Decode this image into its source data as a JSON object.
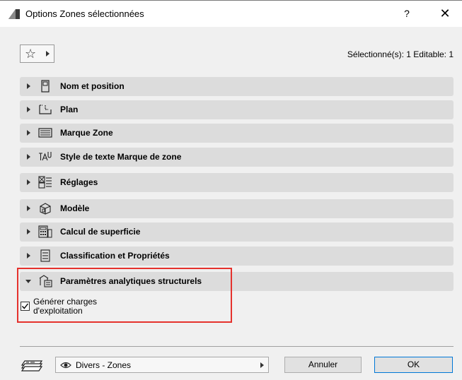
{
  "window": {
    "title": "Options Zones sélectionnées",
    "help_label": "?",
    "close_label": "✕"
  },
  "toolbar": {
    "favorites_icon": "star-icon",
    "selection_info": "Sélectionné(s): 1 Editable: 1"
  },
  "panels": [
    {
      "label": "Nom et position",
      "icon": "name-position-icon",
      "expanded": false
    },
    {
      "label": "Plan",
      "icon": "floor-plan-icon",
      "expanded": false
    },
    {
      "label": "Marque Zone",
      "icon": "zone-stamp-icon",
      "expanded": false
    },
    {
      "label": "Style de texte Marque de zone",
      "icon": "text-style-icon",
      "expanded": false
    },
    {
      "label": "Réglages",
      "icon": "settings-icon",
      "expanded": false
    },
    {
      "label": "Modèle",
      "icon": "model-icon",
      "expanded": false
    },
    {
      "label": "Calcul de superficie",
      "icon": "area-calculation-icon",
      "expanded": false
    },
    {
      "label": "Classification et Propriétés",
      "icon": "classification-icon",
      "expanded": false
    },
    {
      "label": "Paramètres analytiques structurels",
      "icon": "structural-analytics-icon",
      "expanded": true
    }
  ],
  "structural": {
    "generate_loads_label_line1": "Générer charges",
    "generate_loads_label_line2": "d'exploitation",
    "generate_loads_checked": true
  },
  "footer": {
    "layer_icon": "layer-icon",
    "layer_visibility_icon": "eye-icon",
    "layer_name": "Divers - Zones",
    "cancel_label": "Annuler",
    "ok_label": "OK"
  },
  "colors": {
    "highlight": "#e5322d",
    "panel_bg": "#dcdcdc",
    "ok_border": "#0078d7"
  }
}
